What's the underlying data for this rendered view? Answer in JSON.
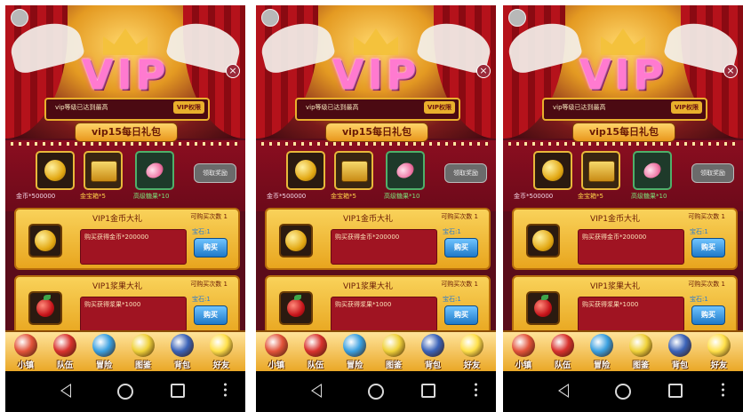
{
  "screen": {
    "vip_logo": "VIP",
    "close_icon": "×",
    "status_text": "vip等级已达到最高",
    "vip_privilege_button": "VIP权限",
    "daily_title": "vip15每日礼包",
    "daily_items": [
      {
        "icon": "gold-coin-icon",
        "label": "金币*500000"
      },
      {
        "icon": "treasure-chest-icon",
        "label": "金宝箱*5"
      },
      {
        "icon": "candy-icon",
        "label": "高级糖果*10"
      }
    ],
    "claim_button": "领取奖励",
    "packs": [
      {
        "title": "VIP1金币大礼",
        "limit": "可购买次数  1",
        "desc": "购买获得金币*200000",
        "gem": "宝石:1",
        "buy": "购买",
        "icon": "gold-coin-icon"
      },
      {
        "title": "VIP1浆果大礼",
        "limit": "可购买次数  1",
        "desc": "购买获得浆果*1000",
        "gem": "宝石:1",
        "buy": "购买",
        "icon": "berry-icon"
      }
    ],
    "nav": [
      {
        "label": "小镇",
        "color": "#e2533a"
      },
      {
        "label": "队伍",
        "color": "#d8322e"
      },
      {
        "label": "冒险",
        "color": "#3aa0e0"
      },
      {
        "label": "图鉴",
        "color": "#f0d23a"
      },
      {
        "label": "背包",
        "color": "#3b63b8"
      },
      {
        "label": "好友",
        "color": "#ffe04a"
      }
    ]
  }
}
